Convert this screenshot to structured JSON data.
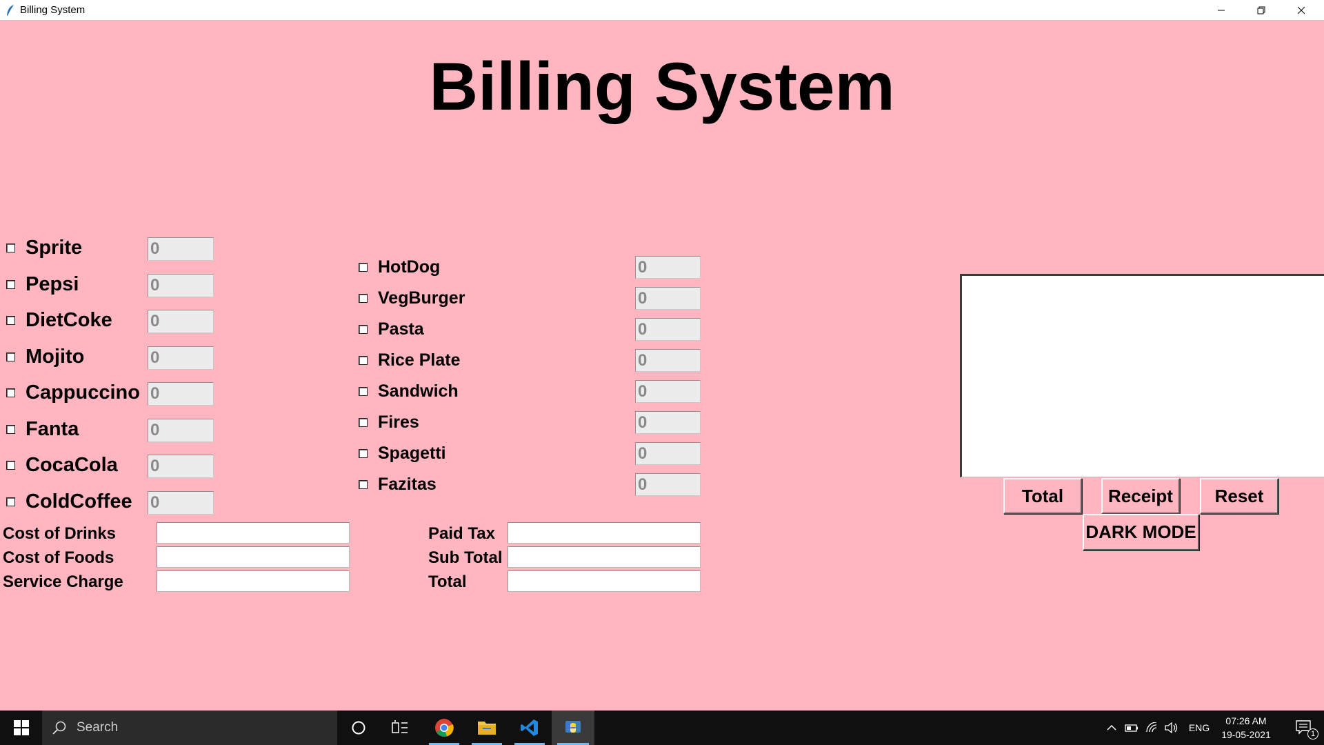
{
  "window": {
    "title": "Billing System"
  },
  "header": {
    "title": "Billing System"
  },
  "drinks": [
    {
      "label": "Sprite",
      "qty": "0"
    },
    {
      "label": "Pepsi",
      "qty": "0"
    },
    {
      "label": "DietCoke",
      "qty": "0"
    },
    {
      "label": "Mojito",
      "qty": "0"
    },
    {
      "label": "Cappuccino",
      "qty": "0"
    },
    {
      "label": "Fanta",
      "qty": "0"
    },
    {
      "label": "CocaCola",
      "qty": "0"
    },
    {
      "label": "ColdCoffee",
      "qty": "0"
    }
  ],
  "foods": [
    {
      "label": "HotDog",
      "qty": "0"
    },
    {
      "label": "VegBurger",
      "qty": "0"
    },
    {
      "label": "Pasta",
      "qty": "0"
    },
    {
      "label": "Rice Plate",
      "qty": "0"
    },
    {
      "label": "Sandwich",
      "qty": "0"
    },
    {
      "label": "Fires",
      "qty": "0"
    },
    {
      "label": "Spagetti",
      "qty": "0"
    },
    {
      "label": "Fazitas",
      "qty": "0"
    }
  ],
  "costs": {
    "cost_of_drinks": "Cost of Drinks",
    "cost_of_foods": "Cost of Foods",
    "service_charge": "Service Charge",
    "paid_tax": "Paid Tax",
    "sub_total": "Sub Total",
    "total": "Total"
  },
  "buttons": {
    "total": "Total",
    "receipt": "Receipt",
    "reset": "Reset",
    "dark_mode": "DARK MODE"
  },
  "taskbar": {
    "search_placeholder": "Search",
    "language": "ENG",
    "time": "07:26 AM",
    "date": "19-05-2021",
    "notification_count": "1"
  },
  "colors": {
    "background": "#ffb6c1",
    "taskbar": "#101010"
  }
}
